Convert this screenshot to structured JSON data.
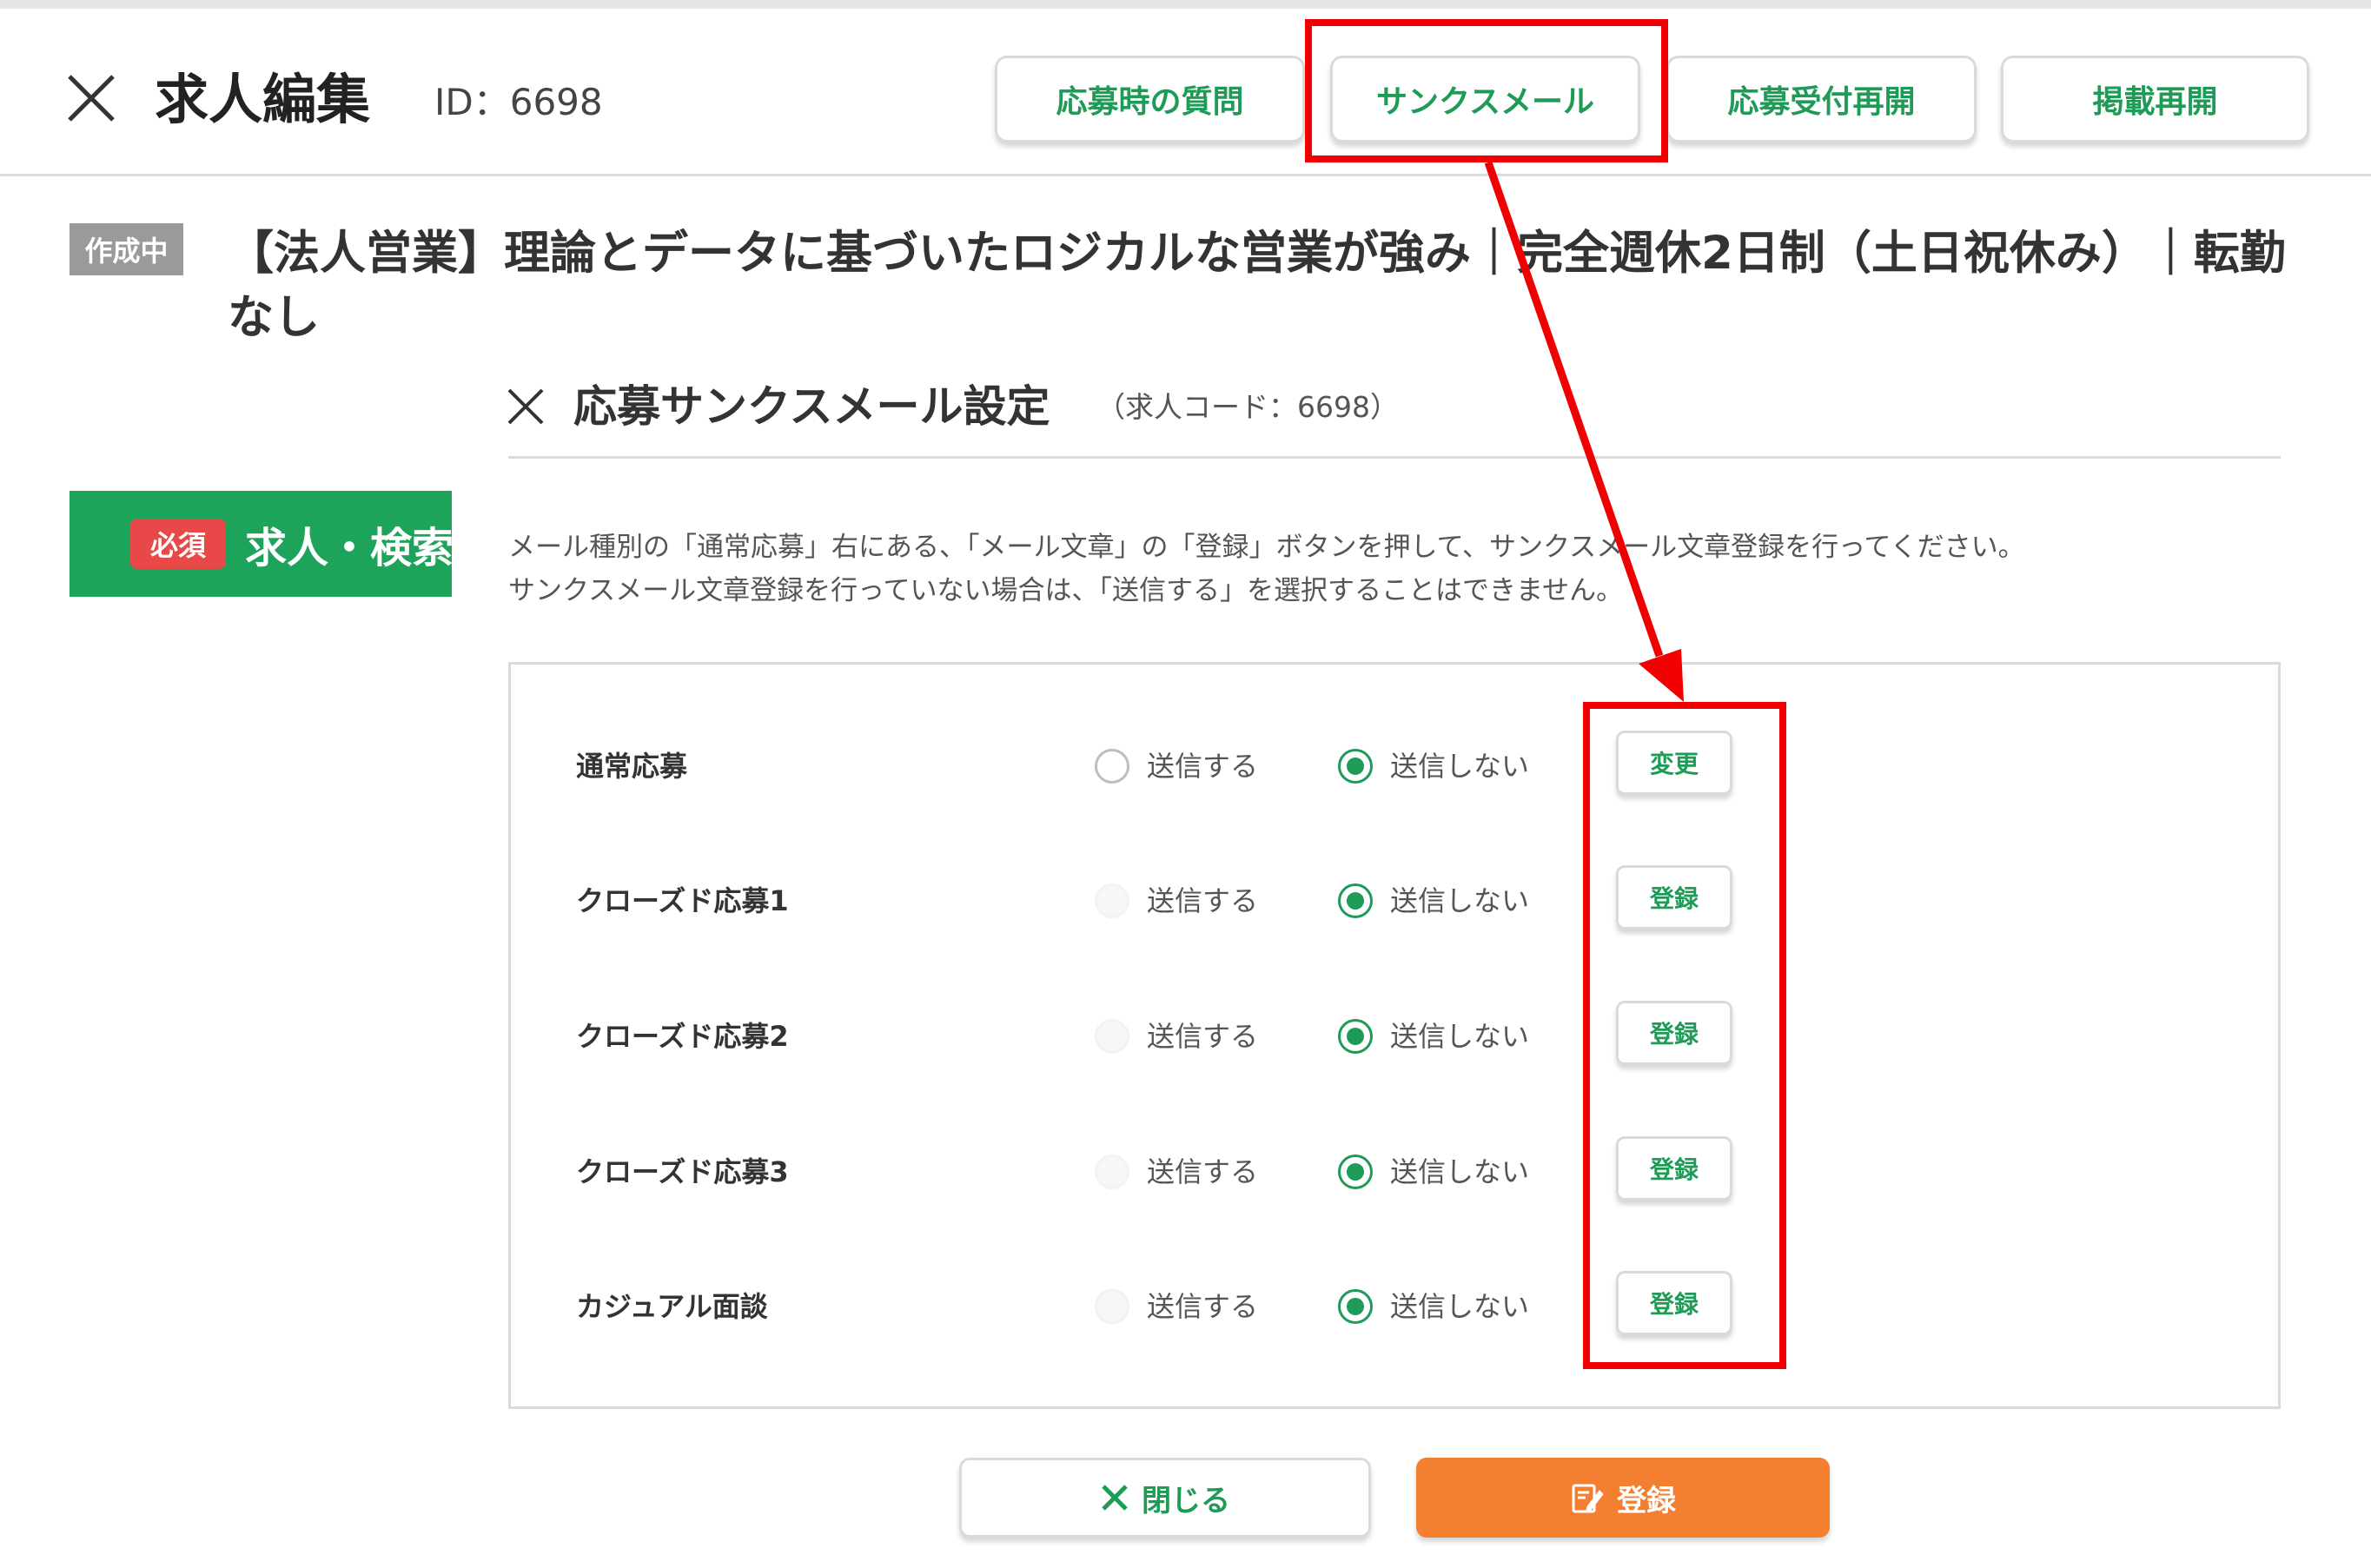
{
  "header": {
    "title": "求人編集",
    "id_text": "ID：6698",
    "buttons": [
      "応募時の質問",
      "サンクスメール",
      "応募受付再開",
      "掲載再開"
    ]
  },
  "job": {
    "status": "作成中",
    "title": "【法人営業】理論とデータに基づいたロジカルな営業が強み｜完全週休2日制（土日祝休み）｜転勤なし"
  },
  "required_section": {
    "badge": "必須",
    "label": "求人・検索"
  },
  "modal": {
    "title": "応募サンクスメール設定",
    "code": "（求人コード：6698）",
    "desc_line1": "メール種別の「通常応募」右にある、「メール文章」の「登録」ボタンを押して、サンクスメール文章登録を行ってください。",
    "desc_line2": "サンクスメール文章登録を行っていない場合は、「送信する」を選択することはできません。",
    "option_send": "送信する",
    "option_nosend": "送信しない",
    "rows": [
      {
        "label": "通常応募",
        "button": "変更"
      },
      {
        "label": "クローズド応募1",
        "button": "登録"
      },
      {
        "label": "クローズド応募2",
        "button": "登録"
      },
      {
        "label": "クローズド応募3",
        "button": "登録"
      },
      {
        "label": "カジュアル面談",
        "button": "登録"
      }
    ],
    "close_label": "閉じる",
    "save_label": "登録"
  },
  "colors": {
    "brand_green": "#1e9b56",
    "accent_orange": "#f57f31",
    "annotation_red": "#f00000",
    "required_red": "#e94848"
  }
}
